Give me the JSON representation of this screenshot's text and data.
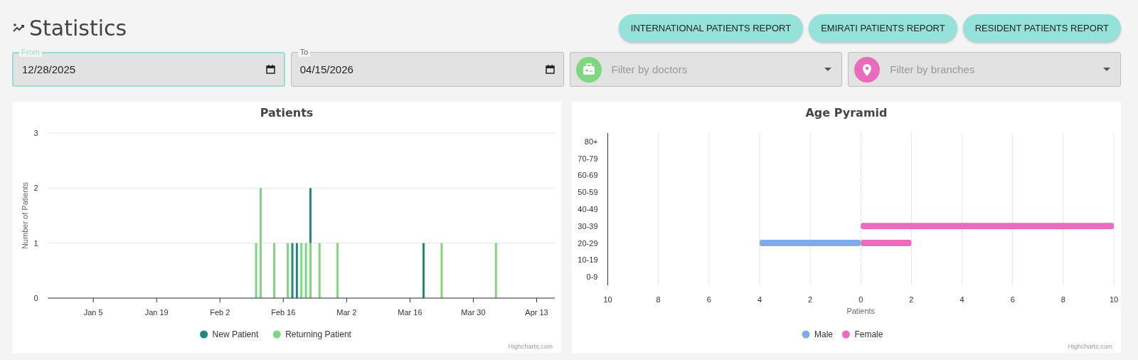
{
  "page": {
    "title": "Statistics"
  },
  "report_buttons": [
    {
      "label": "INTERNATIONAL PATIENTS REPORT"
    },
    {
      "label": "EMIRATI PATIENTS REPORT"
    },
    {
      "label": "RESIDENT PATIENTS REPORT"
    }
  ],
  "filters": {
    "date_fields": [
      {
        "label": "From",
        "value": "12/28/2025",
        "focused": true
      },
      {
        "label": "To",
        "value": "04/15/2026",
        "focused": false
      }
    ],
    "selects": [
      {
        "kind": "doctors",
        "placeholder": "Filter by doctors",
        "color": "#7dd87f"
      },
      {
        "kind": "branches",
        "placeholder": "Filter by branches",
        "color": "#e86bbd"
      }
    ]
  },
  "charts": [
    {
      "credit": "Highcharts.com",
      "chart_data": {
        "type": "bar",
        "title": "Patients",
        "ylabel": "Number of Patients",
        "stacked": true,
        "legend": true,
        "grid": true,
        "x": [
          "2026-02-10",
          "2026-02-11",
          "2026-02-14",
          "2026-02-17",
          "2026-02-18",
          "2026-02-19",
          "2026-02-20",
          "2026-02-21",
          "2026-02-22",
          "2026-02-24",
          "2026-02-28",
          "2026-03-19",
          "2026-03-23",
          "2026-04-04"
        ],
        "series": [
          {
            "name": "New Patient",
            "color": "#1e8a7c",
            "values": [
              null,
              null,
              null,
              null,
              1,
              1,
              null,
              null,
              1,
              null,
              null,
              1,
              null,
              null
            ]
          },
          {
            "name": "Returning Patient",
            "color": "#7ed67e",
            "values": [
              1,
              2,
              1,
              1,
              null,
              null,
              1,
              1,
              1,
              1,
              1,
              null,
              1,
              1
            ]
          }
        ],
        "xlim": [
          "2025-12-26",
          "2026-04-17"
        ],
        "ylim": [
          0,
          3
        ],
        "xticks": [
          {
            "value": "2026-01-05",
            "label": "Jan 5"
          },
          {
            "value": "2026-01-19",
            "label": "Jan 19"
          },
          {
            "value": "2026-02-02",
            "label": "Feb 2"
          },
          {
            "value": "2026-02-16",
            "label": "Feb 16"
          },
          {
            "value": "2026-03-02",
            "label": "Mar 2"
          },
          {
            "value": "2026-03-16",
            "label": "Mar 16"
          },
          {
            "value": "2026-03-30",
            "label": "Mar 30"
          },
          {
            "value": "2026-04-13",
            "label": "Apr 13"
          }
        ],
        "yticks": [
          0,
          1,
          2,
          3
        ]
      }
    },
    {
      "credit": "Highcharts.com",
      "chart_data": {
        "type": "bar",
        "orientation": "horizontal",
        "title": "Age Pyramid",
        "xlabel": "Patients",
        "legend": true,
        "grid": true,
        "ref_lines": [
          {
            "axis": "x",
            "value": 0
          }
        ],
        "categories": [
          "80+",
          "70-79",
          "60-69",
          "50-59",
          "40-49",
          "30-39",
          "20-29",
          "10-19",
          "0-9"
        ],
        "series": [
          {
            "name": "Male",
            "color": "#7cacea",
            "values": [
              null,
              null,
              null,
              null,
              null,
              null,
              -4,
              null,
              null
            ]
          },
          {
            "name": "Female",
            "color": "#ec6bbd",
            "values": [
              null,
              null,
              null,
              null,
              null,
              10,
              2,
              null,
              null
            ]
          }
        ],
        "xlim": [
          -10,
          10
        ],
        "xticks": [
          {
            "value": -10,
            "label": "10"
          },
          {
            "value": -8,
            "label": "8"
          },
          {
            "value": -6,
            "label": "6"
          },
          {
            "value": -4,
            "label": "4"
          },
          {
            "value": -2,
            "label": "2"
          },
          {
            "value": 0,
            "label": "0"
          },
          {
            "value": 2,
            "label": "2"
          },
          {
            "value": 4,
            "label": "4"
          },
          {
            "value": 6,
            "label": "6"
          },
          {
            "value": 8,
            "label": "8"
          },
          {
            "value": 10,
            "label": "10"
          }
        ]
      }
    }
  ]
}
